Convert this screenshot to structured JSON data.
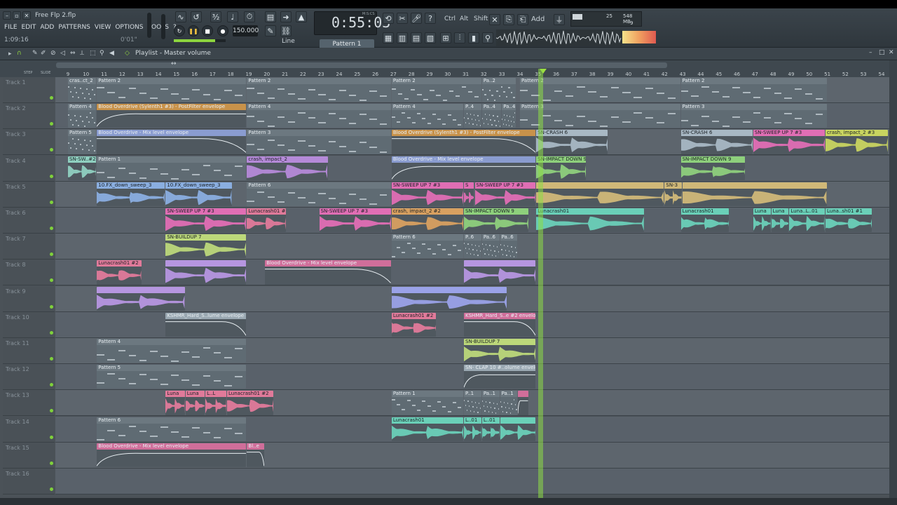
{
  "window": {
    "title": "Free Flp 2.flp"
  },
  "menu": [
    "FILE",
    "EDIT",
    "ADD",
    "PATTERNS",
    "VIEW",
    "OPTIONS",
    "TOOLS",
    "?"
  ],
  "song_position": "1:09:16",
  "hint": "0'01\"",
  "transport": {
    "time": "0:55:03",
    "tempo": "150.000",
    "pattern": "Pattern 1",
    "snap": "Line",
    "time_label": "M:S:CS"
  },
  "tool_labels": {
    "ctrl": "Ctrl",
    "alt": "Alt",
    "shift": "Shift",
    "add": "Add"
  },
  "monitor": {
    "cpu": "25",
    "memory": "548 MB",
    "voices": "9"
  },
  "playlist": {
    "title": "Playlist - Master volume"
  },
  "ruler": [
    9,
    10,
    11,
    12,
    13,
    14,
    15,
    16,
    17,
    18,
    19,
    20,
    21,
    22,
    23,
    24,
    25,
    26,
    27,
    28,
    29,
    30,
    31,
    32,
    33,
    34,
    35,
    36,
    37,
    38,
    39,
    40,
    41,
    42,
    43,
    44,
    45,
    46,
    47,
    48,
    49,
    50,
    51,
    52,
    53,
    54
  ],
  "ruler_extra": [
    "STEP",
    "SLIDE"
  ],
  "tracks": [
    {
      "name": "Track 1",
      "clips": [
        {
          "label": "cras..ct_2",
          "start": 9.0,
          "end": 10.6,
          "kind": "pattern"
        },
        {
          "label": "Pattern 2",
          "start": 10.6,
          "end": 18.9,
          "kind": "pattern"
        },
        {
          "label": "Pattern 2",
          "start": 18.9,
          "end": 26.9,
          "kind": "pattern"
        },
        {
          "label": "Pattern 2",
          "start": 26.9,
          "end": 31.9,
          "kind": "pattern"
        },
        {
          "label": "Pa..2",
          "start": 31.9,
          "end": 33.8,
          "kind": "pattern"
        },
        {
          "label": "Pattern 2",
          "start": 34.0,
          "end": 42.9,
          "kind": "pattern"
        },
        {
          "label": "Pattern 2",
          "start": 42.9,
          "end": 51.0,
          "kind": "pattern"
        }
      ]
    },
    {
      "name": "Track 2",
      "clips": [
        {
          "label": "Pattern 4",
          "start": 9.0,
          "end": 10.6,
          "kind": "pattern"
        },
        {
          "label": "Blood Overdrive (Sylenth1 #3) - PostFilter envelope",
          "start": 10.6,
          "end": 18.9,
          "kind": "auto",
          "color": "#c8924a"
        },
        {
          "label": "Pattern 4",
          "start": 18.9,
          "end": 26.9,
          "kind": "pattern"
        },
        {
          "label": "Pattern 4",
          "start": 26.9,
          "end": 30.9,
          "kind": "pattern"
        },
        {
          "label": "P..4",
          "start": 30.9,
          "end": 31.9,
          "kind": "pattern"
        },
        {
          "label": "Pa..4",
          "start": 31.9,
          "end": 33.0,
          "kind": "pattern"
        },
        {
          "label": "Pa..4",
          "start": 33.0,
          "end": 33.8,
          "kind": "pattern"
        },
        {
          "label": "Pattern 3",
          "start": 34.0,
          "end": 42.9,
          "kind": "pattern"
        },
        {
          "label": "Pattern 3",
          "start": 42.9,
          "end": 51.0,
          "kind": "pattern"
        }
      ]
    },
    {
      "name": "Track 3",
      "clips": [
        {
          "label": "Pattern 5",
          "start": 9.0,
          "end": 10.6,
          "kind": "pattern"
        },
        {
          "label": "Blood Overdrive - Mix level envelope",
          "start": 10.6,
          "end": 18.9,
          "kind": "auto",
          "color": "#8a9cd0"
        },
        {
          "label": "Pattern 3",
          "start": 18.9,
          "end": 26.9,
          "kind": "pattern"
        },
        {
          "label": "Blood Overdrive (Sylenth1 #3) - PostFilter envelope",
          "start": 26.9,
          "end": 34.9,
          "kind": "auto",
          "color": "#c8924a"
        },
        {
          "label": "SN-CRASH 6",
          "start": 34.9,
          "end": 38.9,
          "kind": "audio",
          "color": "#a8b8c4"
        },
        {
          "label": "SN-CRASH 6",
          "start": 42.9,
          "end": 46.9,
          "kind": "audio",
          "color": "#a8b8c4"
        },
        {
          "label": "SN-SWEEP UP 7 #3",
          "start": 46.9,
          "end": 50.9,
          "kind": "audio",
          "color": "#e06eb4"
        },
        {
          "label": "crash, impact_2 #3",
          "start": 50.9,
          "end": 55.5,
          "kind": "audio",
          "color": "#c8d460"
        }
      ]
    },
    {
      "name": "Track 4",
      "clips": [
        {
          "label": "SN-SW..#2",
          "start": 9.0,
          "end": 10.6,
          "kind": "audio",
          "color": "#8fd0c0"
        },
        {
          "label": "Pattern 1",
          "start": 10.6,
          "end": 18.9,
          "kind": "pattern"
        },
        {
          "label": "crash, impact_2",
          "start": 18.9,
          "end": 23.4,
          "kind": "audio",
          "color": "#b58ad8"
        },
        {
          "label": "Blood Overdrive - Mix level envelope",
          "start": 26.9,
          "end": 34.9,
          "kind": "auto",
          "color": "#8a9cd0"
        },
        {
          "label": "SN-IMPACT DOWN 9",
          "start": 34.9,
          "end": 37.7,
          "kind": "audio",
          "color": "#8ed07c"
        },
        {
          "label": "SN-IMPACT DOWN 9",
          "start": 42.9,
          "end": 46.5,
          "kind": "audio",
          "color": "#8ed07c"
        }
      ]
    },
    {
      "name": "Track 5",
      "clips": [
        {
          "label": "10.FX_down_sweep_3",
          "start": 10.6,
          "end": 14.4,
          "kind": "audio",
          "color": "#8aaee0"
        },
        {
          "label": "10.FX_down_sweep_3",
          "start": 14.4,
          "end": 18.1,
          "kind": "audio",
          "color": "#8aaee0"
        },
        {
          "label": "Pattern 6",
          "start": 18.9,
          "end": 26.9,
          "kind": "pattern"
        },
        {
          "label": "SN-SWEEP UP 7 #3",
          "start": 26.9,
          "end": 30.9,
          "kind": "audio",
          "color": "#e06eb4"
        },
        {
          "label": "S",
          "start": 30.9,
          "end": 31.5,
          "kind": "audio",
          "color": "#e06eb4"
        },
        {
          "label": "SN-SWEEP UP 7 #3",
          "start": 31.5,
          "end": 34.9,
          "kind": "audio",
          "color": "#e06eb4"
        },
        {
          "label": "",
          "start": 34.9,
          "end": 42.0,
          "kind": "audio",
          "color": "#d0b878"
        },
        {
          "label": "SN-3",
          "start": 42.0,
          "end": 43.0,
          "kind": "audio",
          "color": "#d0b878"
        },
        {
          "label": "",
          "start": 43.0,
          "end": 51.0,
          "kind": "audio",
          "color": "#d0b878"
        }
      ]
    },
    {
      "name": "Track 6",
      "clips": [
        {
          "label": "SN-SWEEP UP 7 #3",
          "start": 14.4,
          "end": 18.9,
          "kind": "audio",
          "color": "#e06eb4"
        },
        {
          "label": "Lunacrash01 #2",
          "start": 18.9,
          "end": 21.1,
          "kind": "audio",
          "color": "#e07a9a"
        },
        {
          "label": "SN-SWEEP UP 7 #3",
          "start": 22.9,
          "end": 26.9,
          "kind": "audio",
          "color": "#e06eb4"
        },
        {
          "label": "crash, impact_2 #2",
          "start": 26.9,
          "end": 30.9,
          "kind": "audio",
          "color": "#d8a060"
        },
        {
          "label": "SN-IMPACT DOWN 9",
          "start": 30.9,
          "end": 34.5,
          "kind": "audio",
          "color": "#8ed07c"
        },
        {
          "label": "Lunacrash01",
          "start": 34.9,
          "end": 40.9,
          "kind": "audio",
          "color": "#6ad0b8"
        },
        {
          "label": "Lunacrash01",
          "start": 42.9,
          "end": 45.6,
          "kind": "audio",
          "color": "#6ad0b8"
        },
        {
          "label": "Luna",
          "start": 46.9,
          "end": 47.9,
          "kind": "audio",
          "color": "#6ad0b8"
        },
        {
          "label": "Luna",
          "start": 47.9,
          "end": 48.9,
          "kind": "audio",
          "color": "#6ad0b8"
        },
        {
          "label": "Luna..L..01",
          "start": 48.9,
          "end": 50.9,
          "kind": "audio",
          "color": "#6ad0b8"
        },
        {
          "label": "Luna..sh01 #1",
          "start": 50.9,
          "end": 53.5,
          "kind": "audio",
          "color": "#6ad0b8"
        }
      ]
    },
    {
      "name": "Track 7",
      "clips": [
        {
          "label": "SN-BUILDUP 7",
          "start": 14.4,
          "end": 18.9,
          "kind": "audio",
          "color": "#bcd87a"
        },
        {
          "label": "Pattern 6",
          "start": 26.9,
          "end": 30.9,
          "kind": "pattern"
        },
        {
          "label": "P..6",
          "start": 30.9,
          "end": 31.9,
          "kind": "pattern"
        },
        {
          "label": "Pa..6",
          "start": 31.9,
          "end": 32.9,
          "kind": "pattern"
        },
        {
          "label": "Pa..6",
          "start": 32.9,
          "end": 33.9,
          "kind": "pattern"
        }
      ]
    },
    {
      "name": "Track 8",
      "clips": [
        {
          "label": "Lunacrash01 #2",
          "start": 10.6,
          "end": 13.1,
          "kind": "audio",
          "color": "#e07a9a"
        },
        {
          "label": "",
          "start": 14.4,
          "end": 18.9,
          "kind": "audio",
          "color": "#b696e0"
        },
        {
          "label": "Blood Overdrive - Mix level envelope",
          "start": 19.9,
          "end": 26.9,
          "kind": "auto",
          "color": "#d06e9a"
        },
        {
          "label": "",
          "start": 30.9,
          "end": 34.9,
          "kind": "audio",
          "color": "#b696e0"
        }
      ]
    },
    {
      "name": "Track 9",
      "clips": [
        {
          "label": "",
          "start": 10.6,
          "end": 15.5,
          "kind": "audio",
          "color": "#b696e0"
        },
        {
          "label": "",
          "start": 26.9,
          "end": 33.3,
          "kind": "audio",
          "color": "#9aa2e8"
        }
      ]
    },
    {
      "name": "Track 10",
      "clips": [
        {
          "label": "KSHMR_Hard_S..lume envelope",
          "start": 14.4,
          "end": 18.9,
          "kind": "auto",
          "color": "#9aa8b2"
        },
        {
          "label": "Lunacrash01 #2",
          "start": 26.9,
          "end": 29.4,
          "kind": "audio",
          "color": "#e07a9a"
        },
        {
          "label": "KSHMR_Hard_S..e #2 envelope",
          "start": 30.9,
          "end": 34.9,
          "kind": "auto",
          "color": "#d06e9a"
        }
      ]
    },
    {
      "name": "Track 11",
      "clips": [
        {
          "label": "Pattern 4",
          "start": 10.6,
          "end": 18.9,
          "kind": "pattern"
        },
        {
          "label": "SN-BUILDUP 7",
          "start": 30.9,
          "end": 34.9,
          "kind": "audio",
          "color": "#bcd87a"
        }
      ]
    },
    {
      "name": "Track 12",
      "clips": [
        {
          "label": "Pattern 5",
          "start": 10.6,
          "end": 18.9,
          "kind": "pattern"
        },
        {
          "label": "SN- CLAP 10 #..olume envelope",
          "start": 30.9,
          "end": 34.9,
          "kind": "auto",
          "color": "#9aa8b2"
        }
      ]
    },
    {
      "name": "Track 13",
      "clips": [
        {
          "label": "Luna",
          "start": 14.4,
          "end": 15.5,
          "kind": "audio",
          "color": "#e07a9a"
        },
        {
          "label": "Luna",
          "start": 15.5,
          "end": 16.6,
          "kind": "audio",
          "color": "#e07a9a"
        },
        {
          "label": "L..L",
          "start": 16.6,
          "end": 17.8,
          "kind": "audio",
          "color": "#e07a9a"
        },
        {
          "label": "Lunacrash01 #2",
          "start": 17.8,
          "end": 20.4,
          "kind": "audio",
          "color": "#e07a9a"
        },
        {
          "label": "Pattern 1",
          "start": 26.9,
          "end": 30.9,
          "kind": "pattern"
        },
        {
          "label": "P..1",
          "start": 30.9,
          "end": 31.9,
          "kind": "pattern"
        },
        {
          "label": "Pa..1",
          "start": 31.9,
          "end": 32.9,
          "kind": "pattern"
        },
        {
          "label": "Pa..1",
          "start": 32.9,
          "end": 33.9,
          "kind": "pattern"
        },
        {
          "label": "",
          "start": 33.9,
          "end": 34.5,
          "kind": "auto",
          "color": "#d06e9a"
        }
      ]
    },
    {
      "name": "Track 14",
      "clips": [
        {
          "label": "Pattern 6",
          "start": 10.6,
          "end": 18.9,
          "kind": "pattern"
        },
        {
          "label": "Lunacrash01",
          "start": 26.9,
          "end": 30.9,
          "kind": "audio",
          "color": "#6ad0b8"
        },
        {
          "label": "L..01",
          "start": 30.9,
          "end": 31.9,
          "kind": "audio",
          "color": "#6ad0b8"
        },
        {
          "label": "L..01",
          "start": 31.9,
          "end": 32.9,
          "kind": "audio",
          "color": "#6ad0b8"
        },
        {
          "label": "",
          "start": 32.9,
          "end": 34.9,
          "kind": "audio",
          "color": "#6ad0b8"
        }
      ]
    },
    {
      "name": "Track 15",
      "clips": [
        {
          "label": "Blood Overdrive - Mix level envelope",
          "start": 10.6,
          "end": 18.9,
          "kind": "auto",
          "color": "#d06e9a"
        },
        {
          "label": "Bl..e",
          "start": 18.9,
          "end": 19.9,
          "kind": "auto",
          "color": "#d06e9a"
        }
      ]
    },
    {
      "name": "Track 16",
      "clips": []
    }
  ]
}
